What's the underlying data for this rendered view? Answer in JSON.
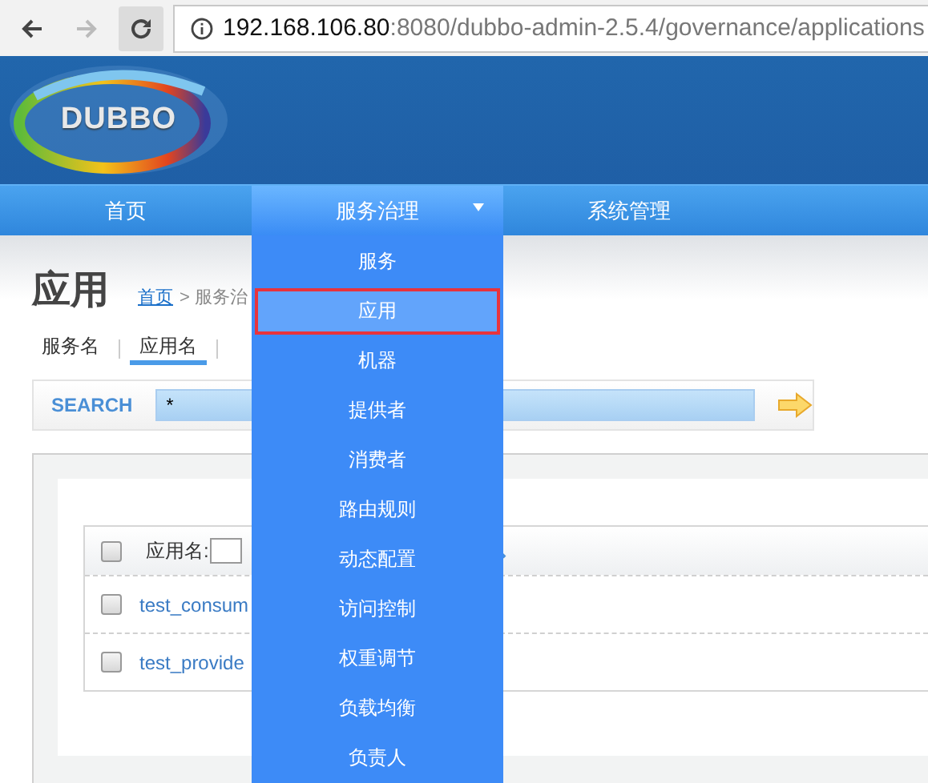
{
  "browser": {
    "url_host": "192.168.106.80",
    "url_path": ":8080/dubbo-admin-2.5.4/governance/applications",
    "forward_disabled": true
  },
  "logo": {
    "text": "DUBBO"
  },
  "nav": [
    {
      "label": "首页",
      "selected": false,
      "has_menu": false
    },
    {
      "label": "服务治理",
      "selected": true,
      "has_menu": true
    },
    {
      "label": "系统管理",
      "selected": false,
      "has_menu": true
    }
  ],
  "page": {
    "title": "应用",
    "breadcrumb": [
      {
        "label": "首页",
        "kind": "link"
      },
      {
        "label": "> 服务治",
        "kind": "text"
      }
    ]
  },
  "filter_tabs": [
    {
      "label": "服务名",
      "selected": false
    },
    {
      "label": "应用名",
      "selected": true
    }
  ],
  "search": {
    "label": "SEARCH",
    "value": "*"
  },
  "table": {
    "header": {
      "label": "应用名:",
      "checked": false
    },
    "rows": [
      {
        "name": "test_consum",
        "checked": false
      },
      {
        "name": "test_provide",
        "checked": false
      }
    ]
  },
  "dropdown": {
    "items": [
      {
        "label": "服务",
        "selected": false
      },
      {
        "label": "应用",
        "selected": true
      },
      {
        "label": "机器",
        "selected": false
      },
      {
        "label": "提供者",
        "selected": false
      },
      {
        "label": "消费者",
        "selected": false
      },
      {
        "label": "路由规则",
        "selected": false
      },
      {
        "label": "动态配置",
        "selected": false
      },
      {
        "label": "访问控制",
        "selected": false
      },
      {
        "label": "权重调节",
        "selected": false
      },
      {
        "label": "负载均衡",
        "selected": false
      },
      {
        "label": "负责人",
        "selected": false
      }
    ]
  }
}
